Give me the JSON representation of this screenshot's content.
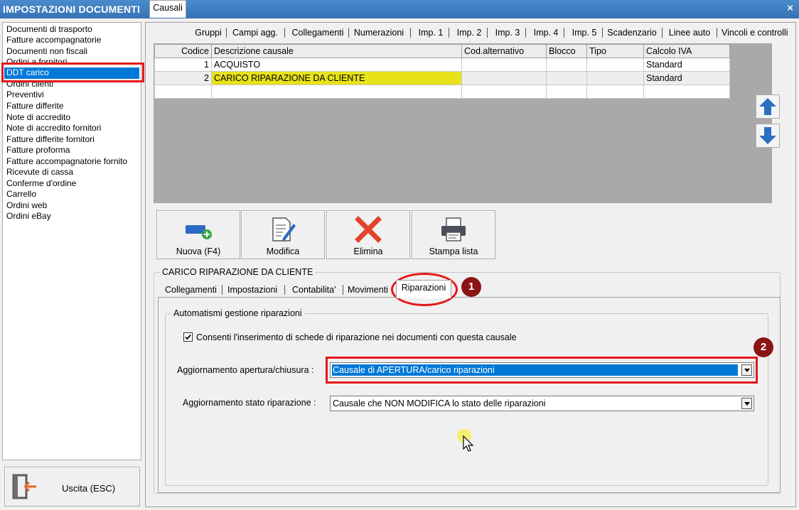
{
  "window": {
    "title": "IMPOSTAZIONI DOCUMENTI",
    "close": "×"
  },
  "sidebar": {
    "items": [
      {
        "label": "Documenti di trasporto"
      },
      {
        "label": "Fatture accompagnatorie"
      },
      {
        "label": "Documenti non fiscali"
      },
      {
        "label": "Ordini a fornitori"
      },
      {
        "label": "DDT carico",
        "selected": true
      },
      {
        "label": "Ordini clienti"
      },
      {
        "label": "Preventivi"
      },
      {
        "label": "Fatture differite"
      },
      {
        "label": "Note di accredito"
      },
      {
        "label": "Note di accredito fornitori"
      },
      {
        "label": "Fatture differite fornitori"
      },
      {
        "label": "Fatture proforma"
      },
      {
        "label": "Fatture accompagnatorie fornito"
      },
      {
        "label": "Ricevute di cassa"
      },
      {
        "label": "Conferme d'ordine"
      },
      {
        "label": "Carrello"
      },
      {
        "label": "Ordini web"
      },
      {
        "label": "Ordini eBay"
      }
    ],
    "exit_label": "Uscita (ESC)"
  },
  "tabs": [
    "Causali",
    "Gruppi",
    "Campi agg.",
    "Collegamenti",
    "Numerazioni",
    "Imp. 1",
    "Imp. 2",
    "Imp. 3",
    "Imp. 4",
    "Imp. 5",
    "Scadenzario",
    "Linee auto",
    "Vincoli e controlli"
  ],
  "active_tab": "Causali",
  "grid": {
    "columns": [
      "Codice",
      "Descrizione causale",
      "Cod.alternativo",
      "Blocco",
      "Tipo",
      "Calcolo IVA"
    ],
    "rows": [
      [
        "1",
        "ACQUISTO",
        "",
        "",
        "",
        "Standard"
      ],
      [
        "2",
        "CARICO RIPARAZIONE DA CLIENTE",
        "",
        "",
        "",
        "Standard"
      ]
    ]
  },
  "toolbar": {
    "new_label": "Nuova (F4)",
    "edit_label": "Modifica",
    "delete_label": "Elimina",
    "print_label": "Stampa lista"
  },
  "detail": {
    "group_title": "CARICO RIPARAZIONE DA CLIENTE",
    "subtabs": [
      "Collegamenti",
      "Impostazioni",
      "Contabilita'",
      "Movimenti",
      "Riparazioni"
    ],
    "active_subtab": "Riparazioni",
    "automation_group": "Automatismi gestione riparazioni",
    "checkbox_label": "Consenti l'inserimento di schede di riparazione nei documenti con questa causale",
    "checkbox_checked": true,
    "open_close_label": "Aggiornamento apertura/chiusura :",
    "open_close_value": "Causale di APERTURA/carico riparazioni",
    "state_label": "Aggiornamento stato riparazione :",
    "state_value": "Causale che NON MODIFICA lo stato delle riparazioni"
  },
  "annotations": {
    "badge1": "1",
    "badge2": "2"
  },
  "colors": {
    "title_bar": "#3d7fc1",
    "selection": "#0078d7",
    "highlight_row": "#e8e21a",
    "annotation_red": "#e5171b",
    "badge": "#8b1416"
  }
}
